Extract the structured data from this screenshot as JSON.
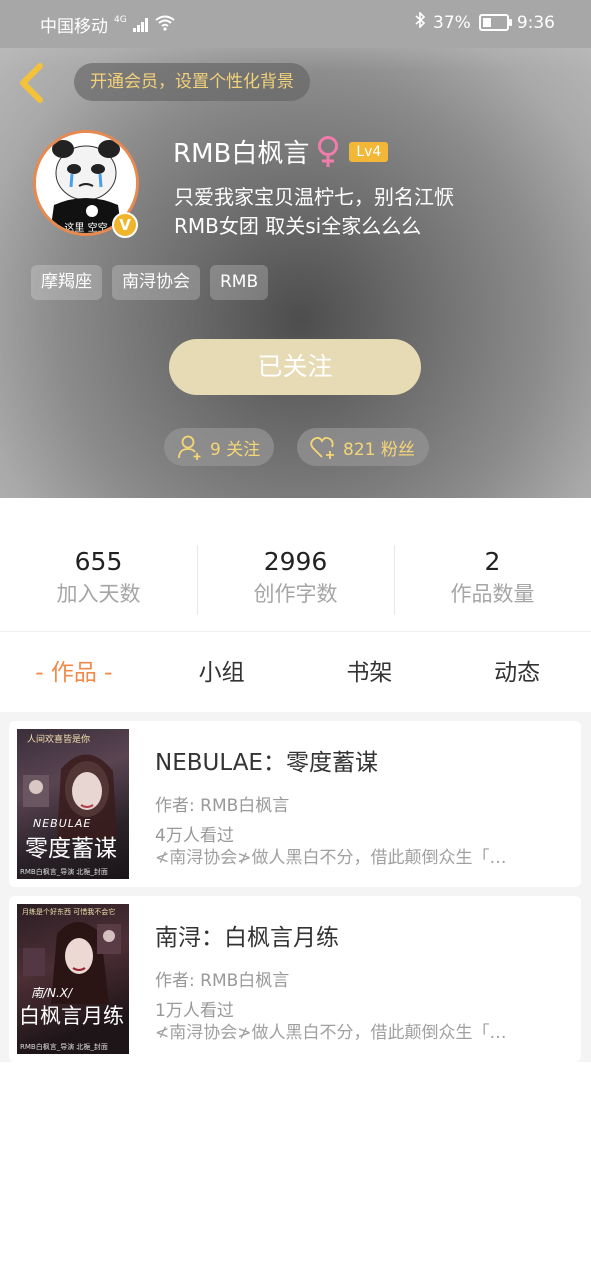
{
  "status_bar": {
    "carrier": "中国移动",
    "network": "4G",
    "battery": "37%",
    "battery_level": 0.37,
    "time": "9:36"
  },
  "header": {
    "vip_banner": "开通会员，设置个性化背景",
    "avatar_caption": "这里 空空",
    "username": "RMB白枫言",
    "level": "Lv4",
    "bio_line1": "只爱我家宝贝温柠七，别名江恹",
    "bio_line2": "RMB女团 取关si全家么么么",
    "tags": [
      "摩羯座",
      "南浔协会",
      "RMB"
    ],
    "follow_button": "已关注",
    "following_label": "9 关注",
    "followers_label": "821 粉丝",
    "accent_color": "#f5d676"
  },
  "stats": [
    {
      "value": "655",
      "label": "加入天数"
    },
    {
      "value": "2996",
      "label": "创作字数"
    },
    {
      "value": "2",
      "label": "作品数量"
    }
  ],
  "tabs": [
    "- 作品 -",
    "小组",
    "书架",
    "动态"
  ],
  "works": [
    {
      "title": "NEBULAE：零度蓄谋",
      "author": "作者: RMB白枫言",
      "views": "4万人看过",
      "desc": "≮南浔协会≯做人黑白不分，借此颠倒众生「…",
      "cover_top": "人间欢喜皆是你",
      "cover_en": "NEBULAE",
      "cover_title": "零度蓄谋",
      "cover_bottom": "RMB白枫言_导演 北梔_封面"
    },
    {
      "title": "南浔：白枫言月练",
      "author": "作者: RMB白枫言",
      "views": "1万人看过",
      "desc": "≮南浔协会≯做人黑白不分，借此颠倒众生「…",
      "cover_top": "月练是个好东西 可惜我不会它",
      "cover_en": "南/N.X/",
      "cover_title": "白枫言月练",
      "cover_bottom": "RMB白枫言_导演 北梔_封面"
    }
  ]
}
